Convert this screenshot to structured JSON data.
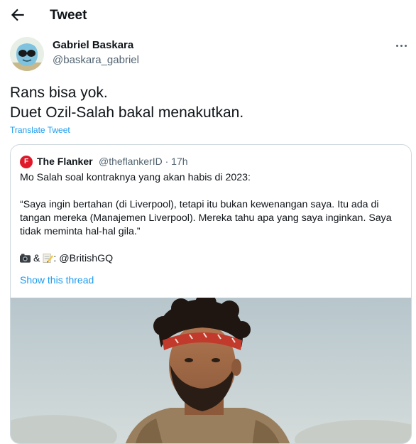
{
  "header": {
    "title": "Tweet"
  },
  "tweet": {
    "author_name": "Gabriel Baskara",
    "author_handle": "@baskara_gabriel",
    "text_lines": [
      "Rans bisa yok.",
      "Duet Ozil-Salah bakal menakutkan."
    ],
    "translate_label": "Translate Tweet"
  },
  "quoted": {
    "author_name": "The Flanker",
    "author_handle": "@theflankerID",
    "separator": "·",
    "time": "17h",
    "avatar_letter": "F",
    "paragraphs": [
      "Mo Salah soal kontraknya yang akan habis di 2023:",
      "“Saya ingin bertahan (di Liverpool), tetapi itu bukan kewenangan saya. Itu ada di tangan mereka (Manajemen Liverpool). Mereka tahu apa yang saya inginkan. Saya tidak meminta hal-hal gila.”"
    ],
    "credit_amp": "&",
    "credit_text": ": @BritishGQ",
    "show_thread_label": "Show this thread"
  },
  "colors": {
    "accent": "#1d9bf0",
    "secondary_text": "#536471",
    "border": "#cfd9de",
    "quote_avatar": "#e0192a"
  },
  "icons": [
    "back-arrow-icon",
    "more-options-icon",
    "camera-emoji",
    "memo-emoji"
  ]
}
